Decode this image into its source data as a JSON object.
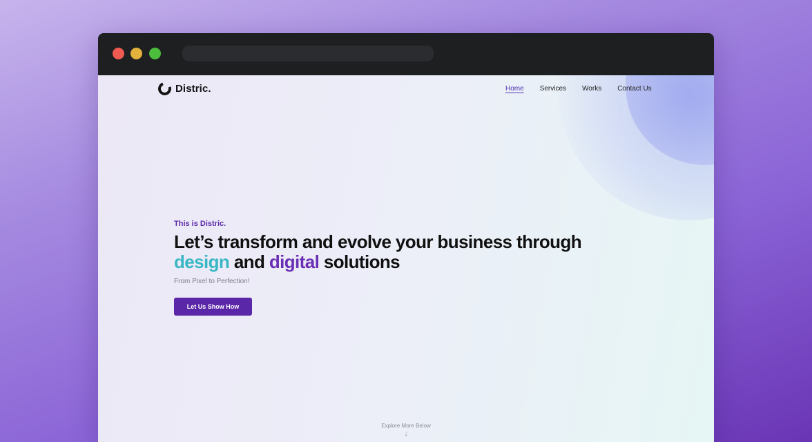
{
  "window": {
    "controls": [
      "close",
      "minimize",
      "maximize"
    ],
    "address": ""
  },
  "brand": {
    "name": "Distric.",
    "icon": "ring-logo-icon"
  },
  "nav": {
    "items": [
      {
        "label": "Home",
        "active": true
      },
      {
        "label": "Services",
        "active": false
      },
      {
        "label": "Works",
        "active": false
      },
      {
        "label": "Contact Us",
        "active": false
      }
    ]
  },
  "hero": {
    "eyebrow": "This is Distric.",
    "headline_line1": "Let’s transform and evolve your business through",
    "headline_word_design": "design",
    "headline_word_and": " and ",
    "headline_word_digital": "digital",
    "headline_word_solutions": " solutions",
    "tagline": "From Pixel to Perfection!",
    "cta_label": "Let Us Show How"
  },
  "footer_hint": {
    "label": "Explore More Below",
    "icon": "arrow-down-icon"
  },
  "colors": {
    "accent_purple": "#5a27a8",
    "accent_teal": "#39b7c4",
    "titlebar": "#1e1f21"
  }
}
